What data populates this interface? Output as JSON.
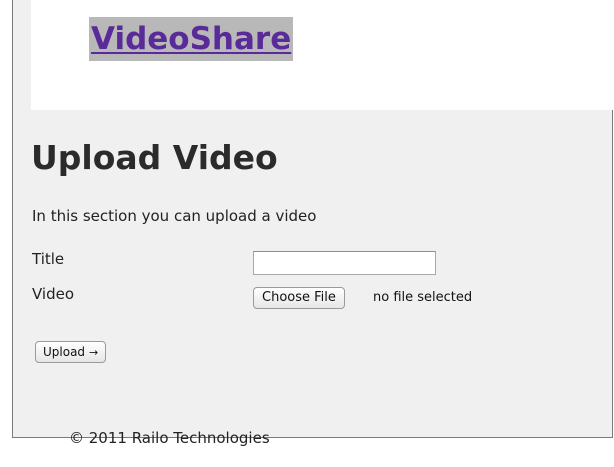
{
  "header": {
    "brand": "VideoShare"
  },
  "main": {
    "title": "Upload Video",
    "intro": "In this section you can upload a video",
    "form": {
      "title_label": "Title",
      "title_value": "",
      "video_label": "Video",
      "choose_file_label": "Choose File",
      "file_status": "no file selected",
      "upload_label": "Upload",
      "upload_icon": "right-arrow-icon",
      "upload_arrow": "→"
    }
  },
  "footer": {
    "copyright": "© 2011 Railo Technologies"
  },
  "colors": {
    "brand_link": "#5a2a98",
    "brand_highlight": "#b8b8b8",
    "page_background": "#f0f0f0",
    "header_background": "#ffffff"
  }
}
